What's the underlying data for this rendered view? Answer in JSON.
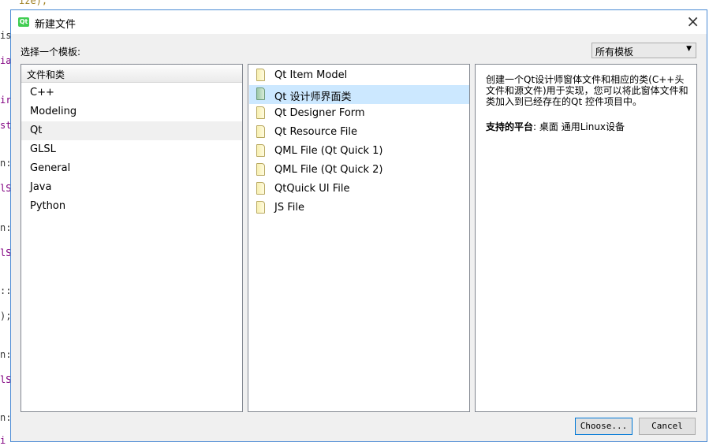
{
  "editor_fragments": {
    "top": "ize);",
    "lines": [
      "is",
      "ia",
      "ir",
      "st",
      "n:",
      "lS",
      "n:",
      "lS",
      "::",
      ");",
      "n:",
      "lS",
      "n:",
      "i"
    ]
  },
  "dialog": {
    "title": "新建文件",
    "app_icon_text": "Qt",
    "close_glyph": "×",
    "template_label": "选择一个模板:",
    "filter_value": "所有模板",
    "filter_arrow": "▼"
  },
  "categories": {
    "header": "文件和类",
    "items": [
      {
        "label": "C++"
      },
      {
        "label": "Modeling"
      },
      {
        "label": "Qt",
        "selected": true
      },
      {
        "label": "GLSL"
      },
      {
        "label": "General"
      },
      {
        "label": "Java"
      },
      {
        "label": "Python"
      }
    ]
  },
  "templates": {
    "items": [
      {
        "label": "Qt Item Model"
      },
      {
        "label": "Qt 设计师界面类",
        "selected": true
      },
      {
        "label": "Qt Designer Form"
      },
      {
        "label": "Qt Resource File"
      },
      {
        "label": "QML File (Qt Quick 1)"
      },
      {
        "label": "QML File (Qt Quick 2)"
      },
      {
        "label": "QtQuick UI File"
      },
      {
        "label": "JS File"
      }
    ]
  },
  "description": {
    "text": "创建一个Qt设计师窗体文件和相应的类(C++头文件和源文件)用于实现，您可以将此窗体文件和类加入到已经存在的Qt 控件项目中。",
    "platform_label": "支持的平台",
    "platform_value": ": 桌面 通用Linux设备"
  },
  "buttons": {
    "choose": "Choose...",
    "cancel": "Cancel"
  }
}
